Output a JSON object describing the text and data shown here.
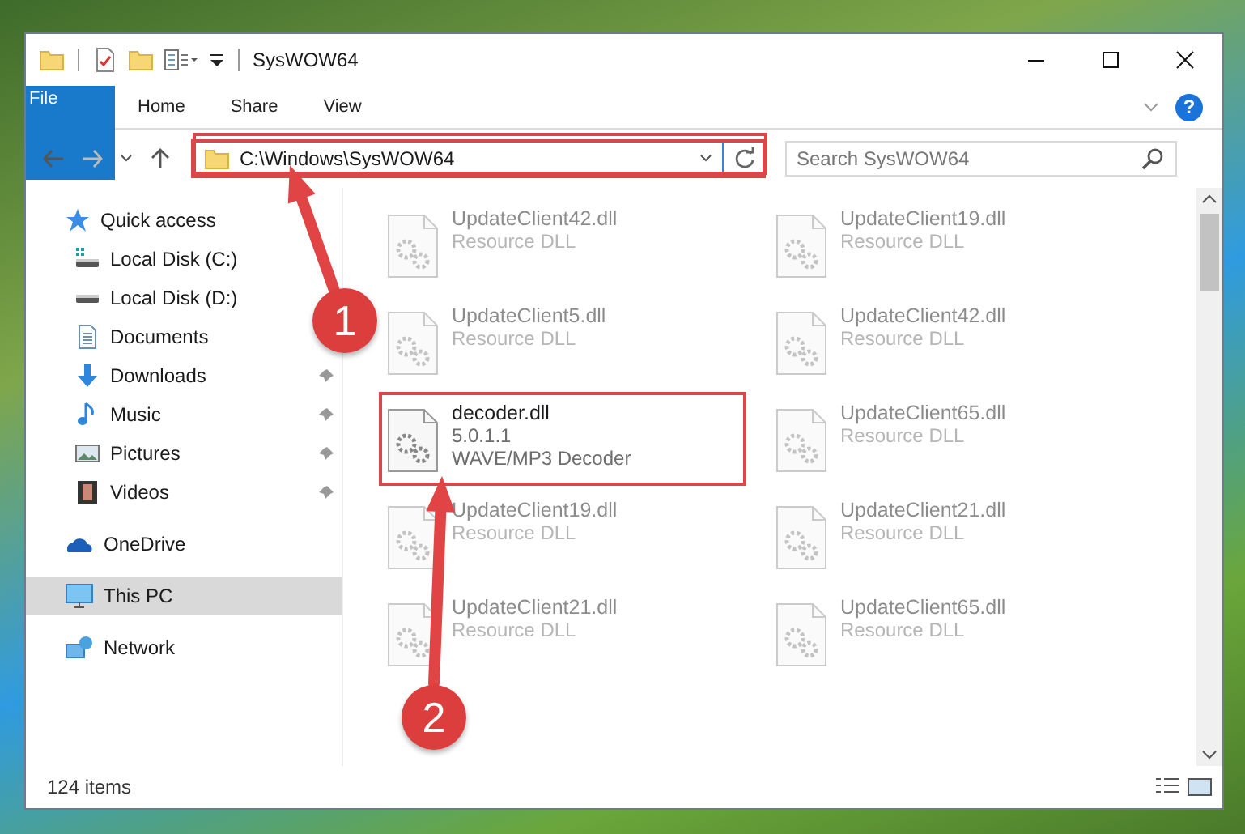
{
  "window": {
    "title": "SysWOW64"
  },
  "ribbon_tabs": [
    {
      "label": "File",
      "kind": "file"
    },
    {
      "label": "Home",
      "kind": "tab"
    },
    {
      "label": "Share",
      "kind": "tab"
    },
    {
      "label": "View",
      "kind": "tab"
    }
  ],
  "help_button": {
    "label": "?"
  },
  "address_bar": {
    "path": "C:\\Windows\\SysWOW64",
    "highlighted": true
  },
  "search": {
    "placeholder": "Search SysWOW64"
  },
  "nav": [
    {
      "label": "Quick access",
      "selected": false,
      "children": [
        {
          "label": "Local Disk (C:)",
          "pinned": false,
          "selected": false
        },
        {
          "label": "Local Disk (D:)",
          "pinned": false,
          "selected": false
        },
        {
          "label": "Documents",
          "pinned": false,
          "selected": false
        },
        {
          "label": "Downloads",
          "pinned": true,
          "selected": false
        },
        {
          "label": "Music",
          "pinned": true,
          "selected": false
        },
        {
          "label": "Pictures",
          "pinned": true,
          "selected": false
        },
        {
          "label": "Videos",
          "pinned": true,
          "selected": false
        }
      ]
    },
    {
      "label": "OneDrive",
      "selected": false
    },
    {
      "label": "This PC",
      "selected": true
    },
    {
      "label": "Network",
      "selected": false
    }
  ],
  "files": [
    {
      "name": "UpdateClient42.dll",
      "details": [
        "Resource DLL"
      ],
      "dimmed": true,
      "highlighted": false
    },
    {
      "name": "UpdateClient19.dll",
      "details": [
        "Resource DLL"
      ],
      "dimmed": true,
      "highlighted": false
    },
    {
      "name": "UpdateClient5.dll",
      "details": [
        "Resource DLL"
      ],
      "dimmed": true,
      "highlighted": false
    },
    {
      "name": "UpdateClient42.dll",
      "details": [
        "Resource DLL"
      ],
      "dimmed": true,
      "highlighted": false
    },
    {
      "name": "decoder.dll",
      "details": [
        "5.0.1.1",
        "WAVE/MP3 Decoder"
      ],
      "dimmed": false,
      "highlighted": true
    },
    {
      "name": "UpdateClient65.dll",
      "details": [
        "Resource DLL"
      ],
      "dimmed": true,
      "highlighted": false
    },
    {
      "name": "UpdateClient19.dll",
      "details": [
        "Resource DLL"
      ],
      "dimmed": true,
      "highlighted": false
    },
    {
      "name": "UpdateClient21.dll",
      "details": [
        "Resource DLL"
      ],
      "dimmed": true,
      "highlighted": false
    },
    {
      "name": "UpdateClient21.dll",
      "details": [
        "Resource DLL"
      ],
      "dimmed": true,
      "highlighted": false
    },
    {
      "name": "UpdateClient65.dll",
      "details": [
        "Resource DLL"
      ],
      "dimmed": true,
      "highlighted": false
    }
  ],
  "status_bar": {
    "item_count": "124 items"
  },
  "callouts": [
    {
      "label": "1"
    },
    {
      "label": "2"
    }
  ]
}
